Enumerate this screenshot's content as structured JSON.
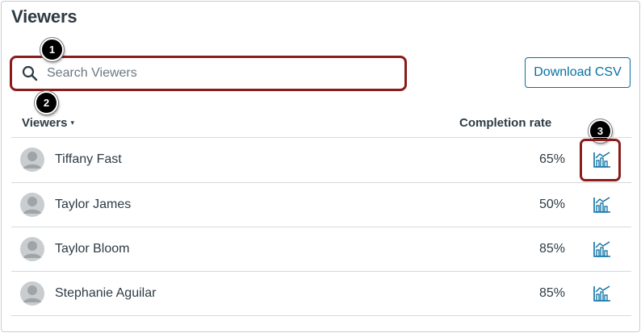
{
  "page": {
    "title": "Viewers"
  },
  "search": {
    "placeholder": "Search Viewers",
    "value": ""
  },
  "toolbar": {
    "download_label": "Download CSV"
  },
  "table": {
    "headers": {
      "viewers": "Viewers",
      "sort_indicator": "▾",
      "completion": "Completion rate"
    },
    "rows": [
      {
        "name": "Tiffany Fast",
        "rate": "65%"
      },
      {
        "name": "Taylor James",
        "rate": "50%"
      },
      {
        "name": "Taylor Bloom",
        "rate": "85%"
      },
      {
        "name": "Stephanie Aguilar",
        "rate": "85%"
      }
    ]
  },
  "callouts": {
    "one": "1",
    "two": "2",
    "three": "3"
  },
  "icons": {
    "search": "search-icon",
    "avatar": "user-avatar-icon",
    "chart": "analytics-chart-icon"
  },
  "colors": {
    "link": "#0770a3",
    "highlight": "#8b1c1c",
    "text": "#2d3b45",
    "avatar": "#b6bcbf"
  }
}
